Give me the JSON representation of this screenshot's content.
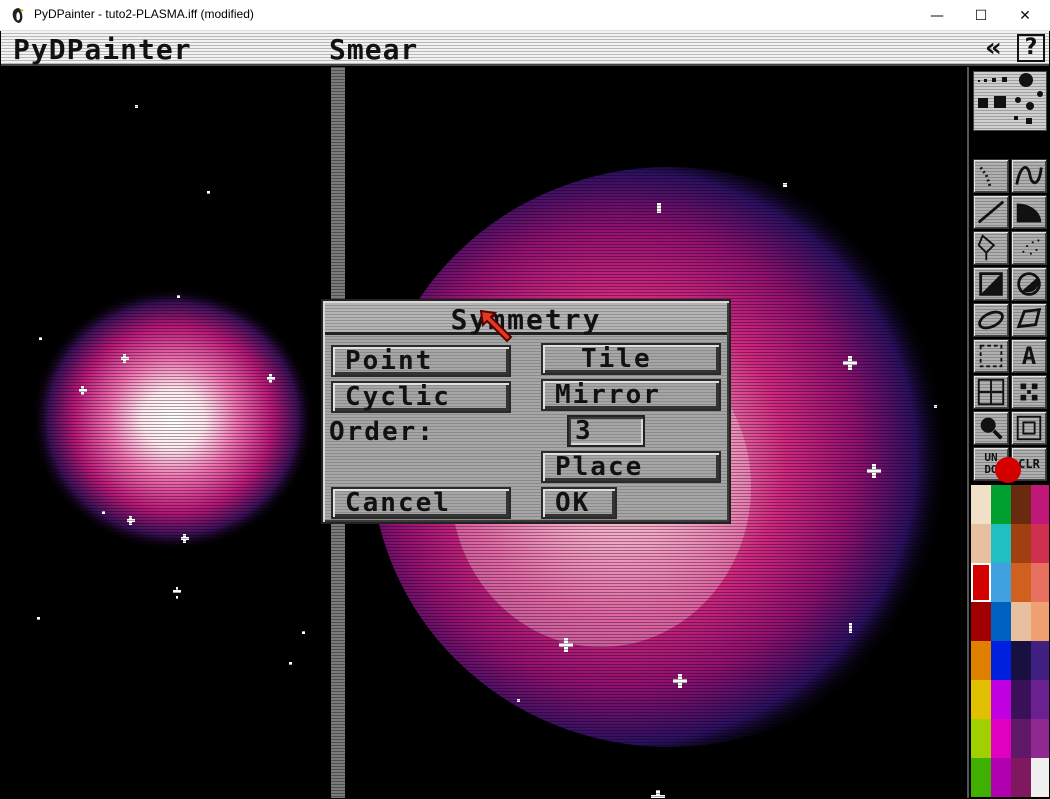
{
  "window": {
    "title": "PyDPainter - tuto2-PLASMA.iff (modified)",
    "minimize_glyph": "—",
    "maximize_glyph": "☐",
    "close_glyph": "✕"
  },
  "menubar": {
    "app_name": "PyDPainter",
    "mode": "Smear",
    "collapse_glyph": "«",
    "help_glyph": "?"
  },
  "dialog": {
    "title": "Symmetry",
    "buttons": {
      "point": "Point",
      "tile": "Tile",
      "cyclic": "Cyclic",
      "mirror": "Mirror",
      "place": "Place",
      "cancel": "Cancel",
      "ok": "OK"
    },
    "order_label": "Order:",
    "order_value": "3"
  },
  "toolbox": {
    "tools": [
      {
        "name": "dotted-freehand-icon"
      },
      {
        "name": "curve-icon"
      },
      {
        "name": "line-icon"
      },
      {
        "name": "arc-icon"
      },
      {
        "name": "fill-icon"
      },
      {
        "name": "airbrush-icon"
      },
      {
        "name": "rectangle-icon"
      },
      {
        "name": "circle-icon"
      },
      {
        "name": "ellipse-icon"
      },
      {
        "name": "polygon-icon"
      },
      {
        "name": "brush-select-icon"
      },
      {
        "name": "text-icon"
      },
      {
        "name": "grid-icon"
      },
      {
        "name": "symmetry-icon"
      },
      {
        "name": "magnify-icon"
      },
      {
        "name": "zoom-icon"
      },
      {
        "name": "undo-icon"
      },
      {
        "name": "clear-icon"
      }
    ],
    "text_tool_label": "A",
    "undo_label_top": "UN",
    "undo_label_bottom": "DO",
    "clear_label": "CLR",
    "foreground_color": "#d40000",
    "palette": [
      [
        "#f0e0c8",
        "#00a030",
        "#6a2a10",
        "#c01878"
      ],
      [
        "#e8c0a0",
        "#20c0c0",
        "#a04010",
        "#d03050"
      ],
      [
        "#d40000",
        "#40a0e0",
        "#d06020",
        "#e87060"
      ],
      [
        "#a00000",
        "#0060c0",
        "#e8c0a0",
        "#f0a070"
      ],
      [
        "#e08000",
        "#0020e0",
        "#181040",
        "#402080"
      ],
      [
        "#e0c000",
        "#c000e0",
        "#3a1058",
        "#6a2090"
      ],
      [
        "#a0d000",
        "#e000c0",
        "#601868",
        "#902890"
      ],
      [
        "#40b000",
        "#b000b0",
        "#801860",
        "#f0f0f0"
      ]
    ],
    "selected_swatch": "2-0"
  }
}
